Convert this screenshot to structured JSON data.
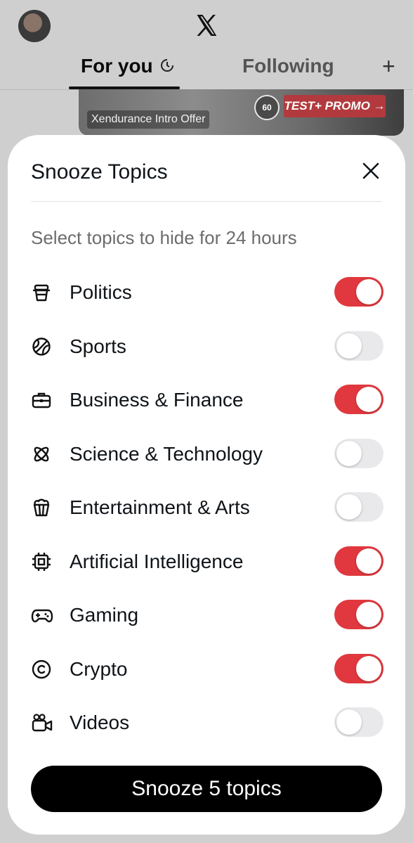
{
  "header": {
    "tabs": [
      {
        "label": "For you",
        "active": true
      },
      {
        "label": "Following",
        "active": false
      }
    ],
    "add_icon": "plus-icon",
    "logo_icon": "x-logo-icon"
  },
  "promo": {
    "label": "Xendurance Intro Offer",
    "badge_text": "60",
    "cta_text": "TEST+ PROMO →"
  },
  "sheet": {
    "title": "Snooze Topics",
    "subtitle": "Select topics to hide for 24 hours",
    "topics": [
      {
        "label": "Politics",
        "icon": "podium-icon",
        "enabled": true
      },
      {
        "label": "Sports",
        "icon": "ball-icon",
        "enabled": false
      },
      {
        "label": "Business & Finance",
        "icon": "briefcase-icon",
        "enabled": true
      },
      {
        "label": "Science & Technology",
        "icon": "atom-icon",
        "enabled": false
      },
      {
        "label": "Entertainment & Arts",
        "icon": "popcorn-icon",
        "enabled": false
      },
      {
        "label": "Artificial Intelligence",
        "icon": "chip-icon",
        "enabled": true
      },
      {
        "label": "Gaming",
        "icon": "gamepad-icon",
        "enabled": true
      },
      {
        "label": "Crypto",
        "icon": "coin-icon",
        "enabled": true
      },
      {
        "label": "Videos",
        "icon": "video-camera-icon",
        "enabled": false
      }
    ],
    "action_label": "Snooze 5 topics"
  },
  "colors": {
    "toggle_on": "#e0383e",
    "toggle_off": "#e9e9ec",
    "primary_button": "#000000"
  }
}
